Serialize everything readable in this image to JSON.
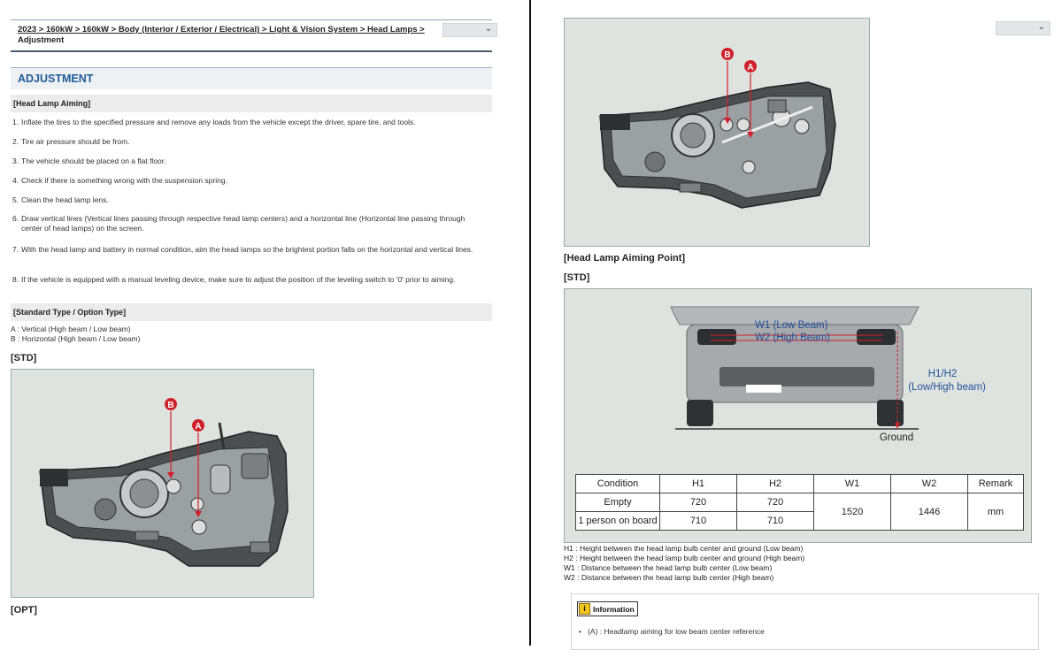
{
  "breadcrumb": {
    "path": "2023 > 160kW > 160kW > Body (Interior / Exterior / Electrical) > Light & Vision System > Head Lamps >",
    "current": "Adjustment"
  },
  "section_title": "ADJUSTMENT",
  "head_lamp_aiming": {
    "heading": "[Head Lamp Aiming]",
    "steps": [
      {
        "num": "1.",
        "text": "Inflate the tires to the specified pressure and remove any loads from the vehicle except the driver, spare tire, and tools."
      },
      {
        "num": "2.",
        "text": "Tire air pressure should be from."
      },
      {
        "num": "3.",
        "text": "The vehicle should be placed on a flat floor."
      },
      {
        "num": "4.",
        "text": "Check if there is something wrong with the suspension spring."
      },
      {
        "num": "5.",
        "text": "Clean the head lamp lens."
      },
      {
        "num": "6.",
        "text": "Draw vertical lines (Vertical lines passing through respective head lamp centers) and a horizontal line (Horizontal line passing through center of head lamps) on the screen."
      },
      {
        "num": "7.",
        "text": "With the head lamp and battery in normal condition, aim the head lamps so the brightest portion falls on the horizontal and vertical lines."
      },
      {
        "num": "8.",
        "text": "If the vehicle is equipped with a manual leveling device, make sure to adjust the position of the leveling switch to '0' prior to aiming."
      }
    ]
  },
  "type_section": {
    "heading": "[Standard Type / Option Type]",
    "legend_a": "A : Vertical (High beam / Low beam)",
    "legend_b": "B : Horizontal (High beam / Low beam)"
  },
  "labels": {
    "std": "[STD]",
    "opt": "[OPT]",
    "aiming_point": "[Head Lamp Aiming Point]",
    "std2": "[STD]",
    "callout_a": "A",
    "callout_b": "B"
  },
  "aiming_figure": {
    "w1": "W1  (Low Beam)",
    "w2": "W2  (High Beam)",
    "h": "H1/H2",
    "h_sub": "(Low/High beam)",
    "ground": "Ground"
  },
  "spec_table": {
    "headers": [
      "Condition",
      "H1",
      "H2",
      "W1",
      "W2",
      "Remark"
    ],
    "row1": {
      "condition": "Empty",
      "h1": "720",
      "h2": "720"
    },
    "row2": {
      "condition": "1 person on board",
      "h1": "710",
      "h2": "710"
    },
    "w1": "1520",
    "w2": "1446",
    "remark": "mm"
  },
  "definitions": [
    "H1 : Height between the head lamp bulb center and ground (Low beam)",
    "H2 : Height between the head lamp bulb center and ground (High beam)",
    "W1 : Distance between the head lamp bulb center (Low beam)",
    "W2 : Distance between the head lamp bulb center (High beam)"
  ],
  "information": {
    "title": "Information",
    "item": "(A) : Headlamp aiming for low beam center reference"
  },
  "colors": {
    "accent": "#1f5c99",
    "callout": "#d0202a",
    "figure_bg": "#dfe3df"
  }
}
